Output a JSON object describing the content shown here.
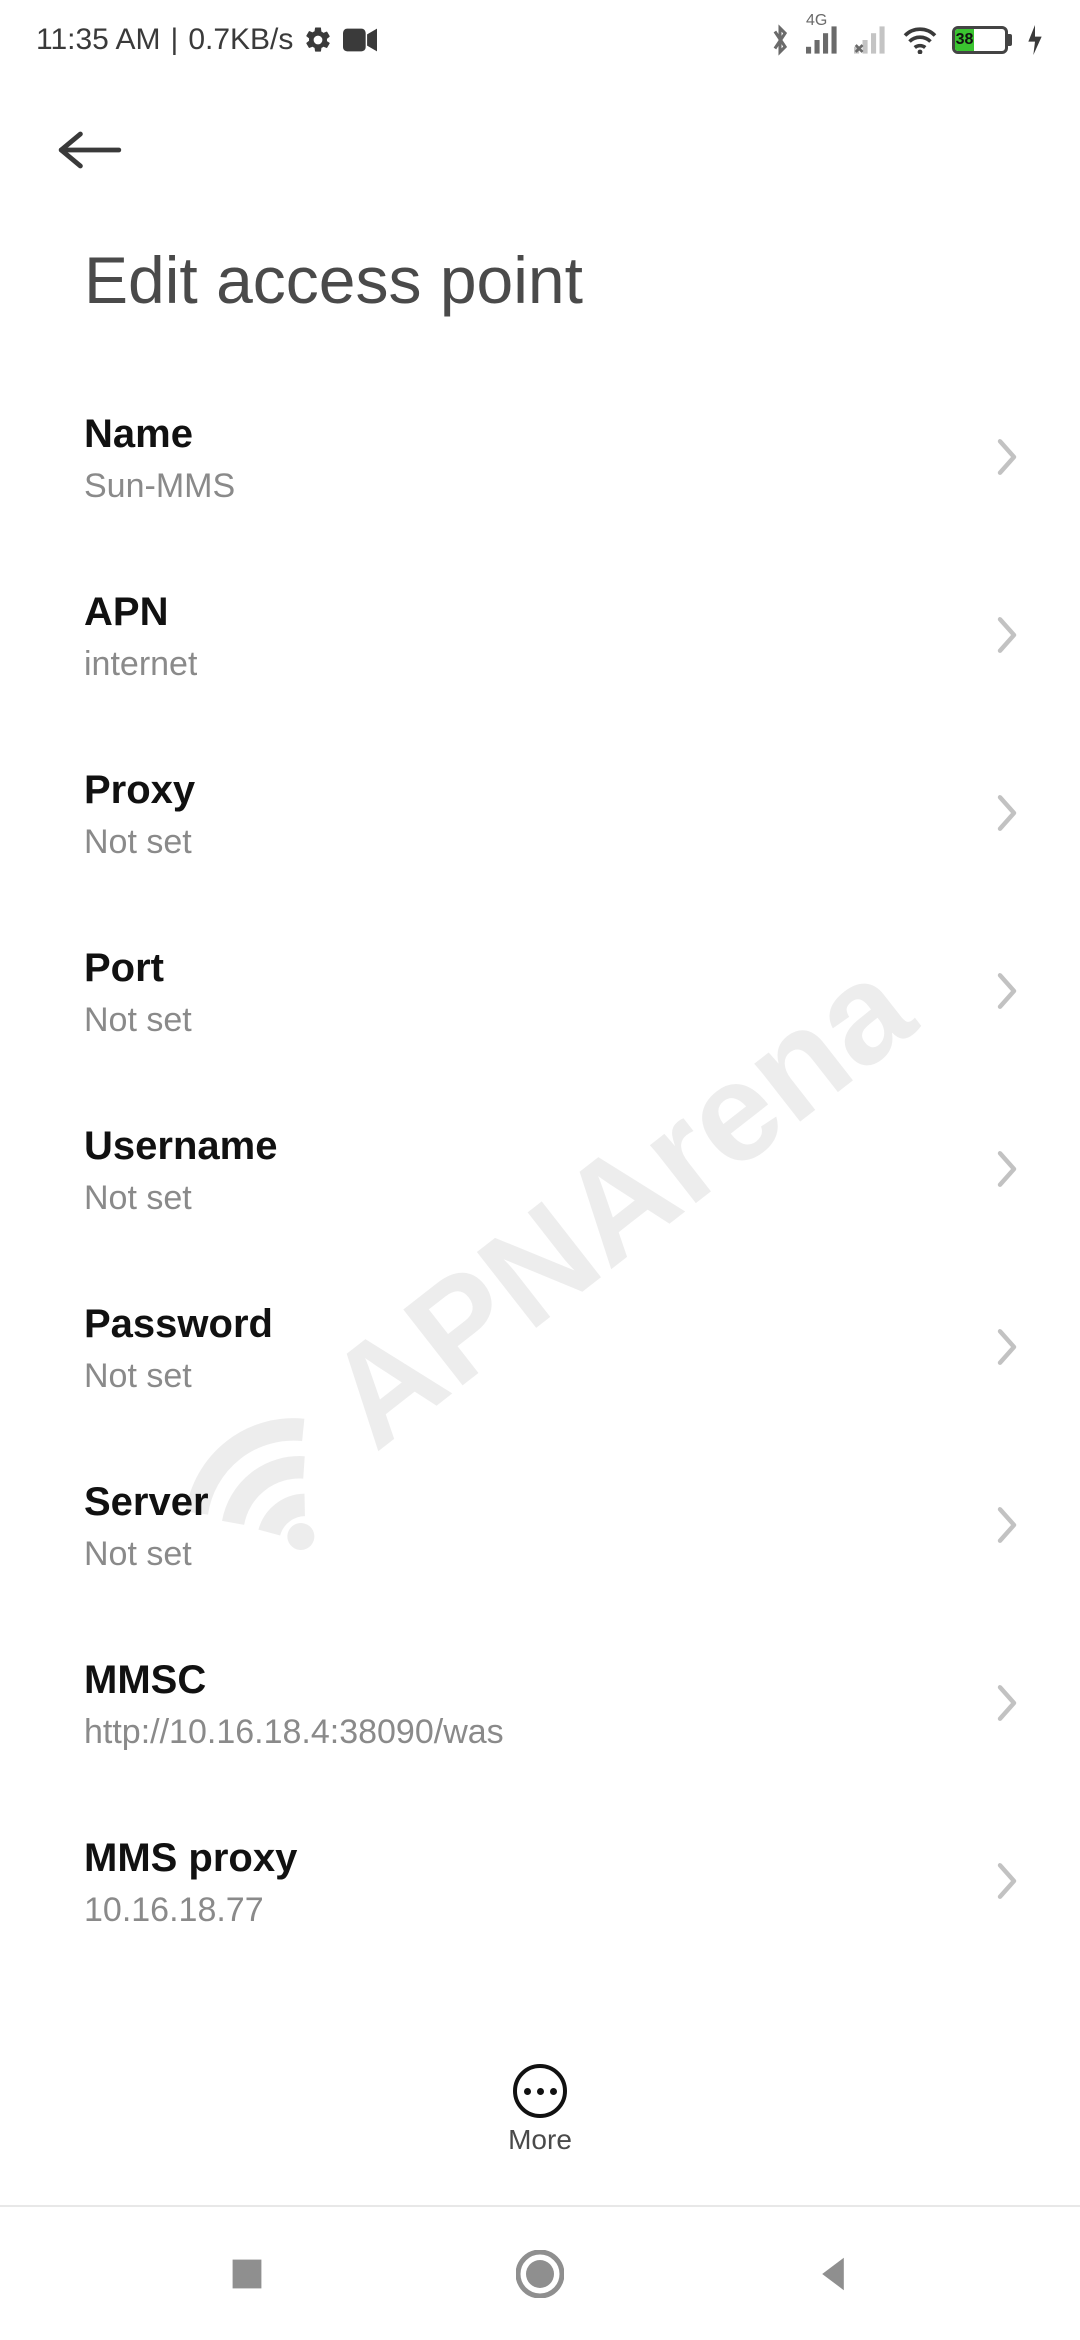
{
  "statusbar": {
    "time": "11:35 AM",
    "net_speed": "0.7KB/s",
    "net_label": "4G",
    "battery_percent": "38"
  },
  "page_title": "Edit access point",
  "rows": [
    {
      "title": "Name",
      "value": "Sun-MMS"
    },
    {
      "title": "APN",
      "value": "internet"
    },
    {
      "title": "Proxy",
      "value": "Not set"
    },
    {
      "title": "Port",
      "value": "Not set"
    },
    {
      "title": "Username",
      "value": "Not set"
    },
    {
      "title": "Password",
      "value": "Not set"
    },
    {
      "title": "Server",
      "value": "Not set"
    },
    {
      "title": "MMSC",
      "value": "http://10.16.18.4:38090/was"
    },
    {
      "title": "MMS proxy",
      "value": "10.16.18.77"
    }
  ],
  "more_label": "More",
  "watermark": "APNArena"
}
